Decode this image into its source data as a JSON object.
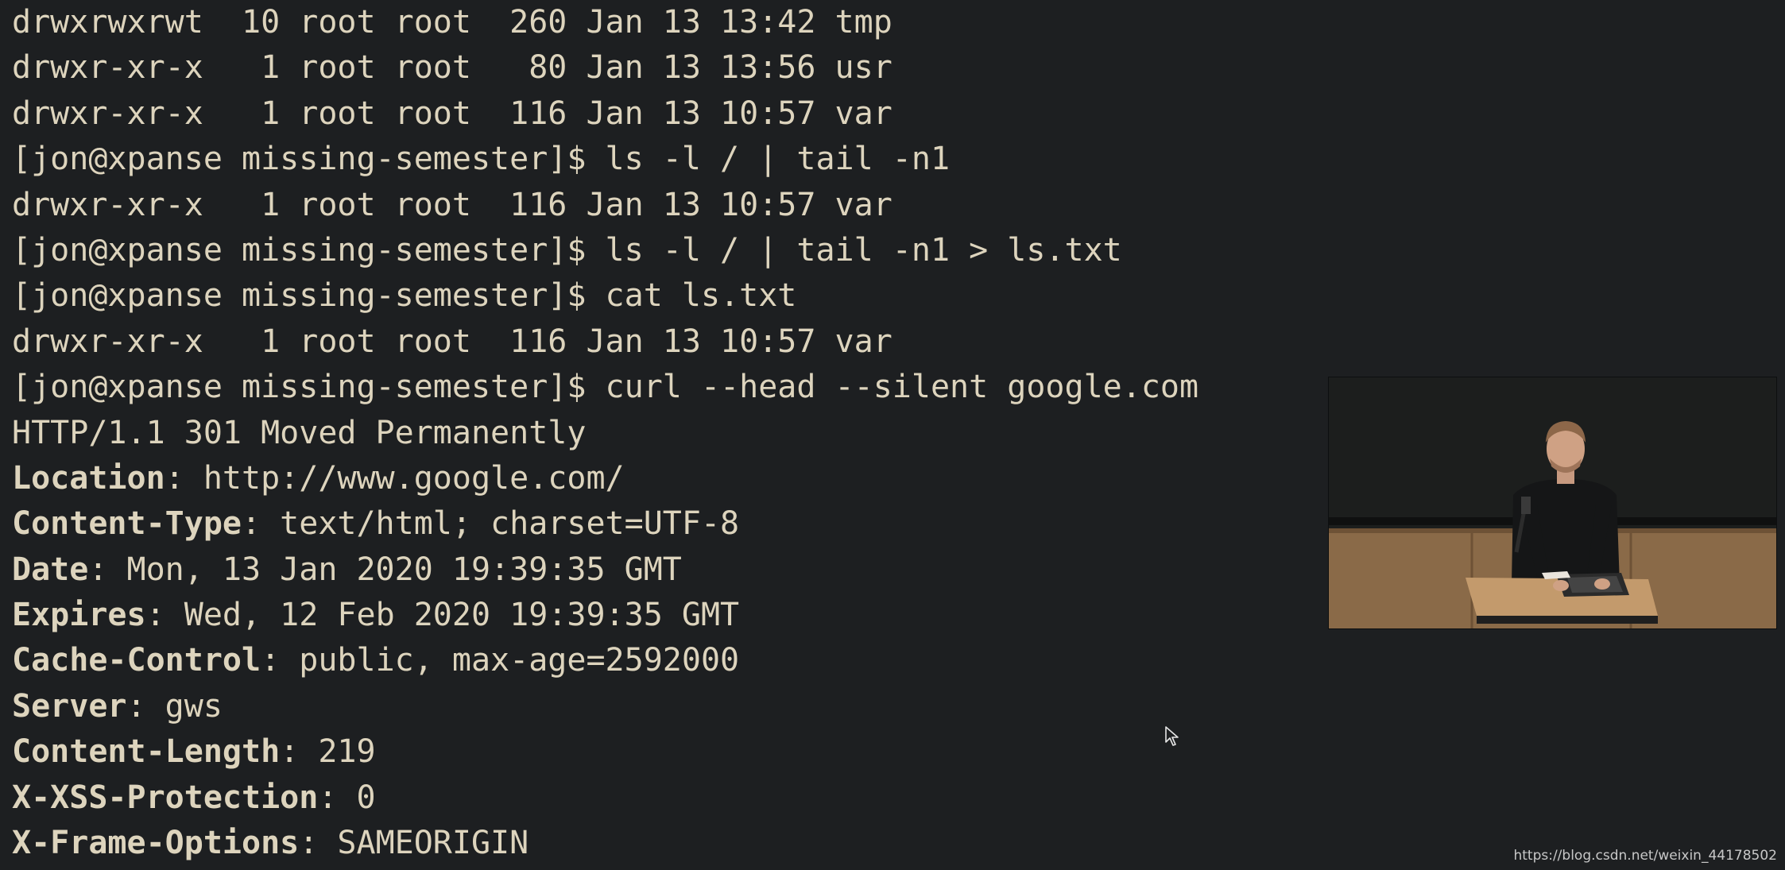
{
  "terminal": {
    "lines": [
      {
        "type": "out",
        "text": "drwxrwxrwt  10 root root  260 Jan 13 13:42 tmp"
      },
      {
        "type": "out",
        "text": "drwxr-xr-x   1 root root   80 Jan 13 13:56 usr"
      },
      {
        "type": "out",
        "text": "drwxr-xr-x   1 root root  116 Jan 13 10:57 var"
      },
      {
        "type": "cmd",
        "prompt": "[jon@xpanse missing-semester]$ ",
        "command": "ls -l / | tail -n1"
      },
      {
        "type": "out",
        "text": "drwxr-xr-x   1 root root  116 Jan 13 10:57 var"
      },
      {
        "type": "cmd",
        "prompt": "[jon@xpanse missing-semester]$ ",
        "command": "ls -l / | tail -n1 > ls.txt"
      },
      {
        "type": "cmd",
        "prompt": "[jon@xpanse missing-semester]$ ",
        "command": "cat ls.txt"
      },
      {
        "type": "out",
        "text": "drwxr-xr-x   1 root root  116 Jan 13 10:57 var"
      },
      {
        "type": "cmd",
        "prompt": "[jon@xpanse missing-semester]$ ",
        "command": "curl --head --silent google.com"
      },
      {
        "type": "out",
        "text": "HTTP/1.1 301 Moved Permanently"
      },
      {
        "type": "hdr",
        "key": "Location",
        "value": ": http://www.google.com/"
      },
      {
        "type": "hdr",
        "key": "Content-Type",
        "value": ": text/html; charset=UTF-8"
      },
      {
        "type": "hdr",
        "key": "Date",
        "value": ": Mon, 13 Jan 2020 19:39:35 GMT"
      },
      {
        "type": "hdr",
        "key": "Expires",
        "value": ": Wed, 12 Feb 2020 19:39:35 GMT"
      },
      {
        "type": "hdr",
        "key": "Cache-Control",
        "value": ": public, max-age=2592000"
      },
      {
        "type": "hdr",
        "key": "Server",
        "value": ": gws"
      },
      {
        "type": "hdr",
        "key": "Content-Length",
        "value": ": 219"
      },
      {
        "type": "hdr",
        "key": "X-XSS-Protection",
        "value": ": 0"
      },
      {
        "type": "hdr",
        "key": "X-Frame-Options",
        "value": ": SAMEORIGIN"
      }
    ]
  },
  "colors": {
    "background": "#1d1f21",
    "text": "#ddd4bd"
  },
  "overlay": {
    "watermark": "https://blog.csdn.net/weixin_44178502",
    "video_icon": "lecturer-webcam-video"
  }
}
